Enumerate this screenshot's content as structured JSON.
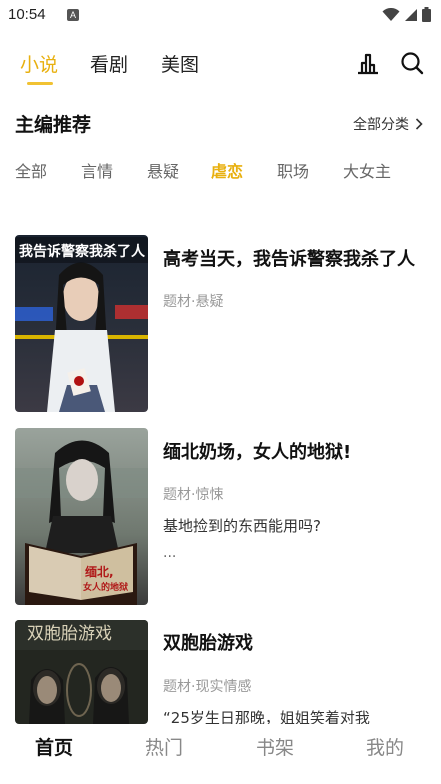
{
  "status_bar": {
    "time": "10:54",
    "a_badge": "A"
  },
  "top_tabs": [
    {
      "label": "小说",
      "active": true
    },
    {
      "label": "看剧",
      "active": false
    },
    {
      "label": "美图",
      "active": false
    }
  ],
  "icons": {
    "ranking": "ranking-icon",
    "search": "search-icon"
  },
  "section": {
    "title": "主编推荐",
    "all_categories": "全部分类"
  },
  "filters": [
    {
      "label": "全部",
      "active": false
    },
    {
      "label": "言情",
      "active": false
    },
    {
      "label": "悬疑",
      "active": false
    },
    {
      "label": "虐恋",
      "active": true
    },
    {
      "label": "职场",
      "active": false
    },
    {
      "label": "大女主",
      "active": false
    }
  ],
  "books": [
    {
      "title": "高考当天，我告诉警察我杀了人",
      "genre": "题材·悬疑",
      "cover_text": "我告诉警察我杀了人",
      "cover_subtext": "",
      "description": "",
      "ellipsis": ""
    },
    {
      "title": "缅北奶场，女人的地狱!",
      "genre": "题材·惊悚",
      "cover_text": "缅北,",
      "cover_subtext": "女人的地狱",
      "description": "基地捡到的东西能用吗?",
      "ellipsis": "..."
    },
    {
      "title": "双胞胎游戏",
      "genre": "题材·现实情感",
      "cover_text": "双胞胎游戏",
      "cover_subtext": "",
      "description": "“25岁生日那晚，姐姐笑着对我",
      "ellipsis": ""
    }
  ],
  "bottom_nav": [
    {
      "label": "首页",
      "active": true
    },
    {
      "label": "热门",
      "active": false
    },
    {
      "label": "书架",
      "active": false
    },
    {
      "label": "我的",
      "active": false
    }
  ],
  "colors": {
    "accent": "#e8b00f",
    "underline": "#f1c232"
  }
}
